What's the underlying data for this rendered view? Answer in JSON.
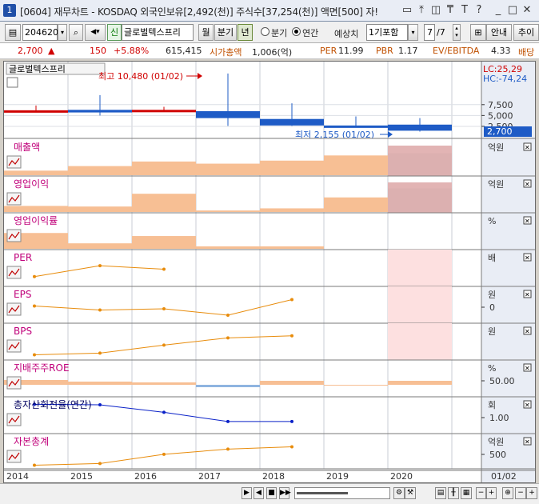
{
  "window": {
    "title": "[0604] 재무차트 - KOSDAQ 외국인보유[2,492(천)] 주식수[37,254(천)] 액면[500] 자!",
    "icon_label": "1"
  },
  "toolbar": {
    "code": "204620",
    "badge": "신",
    "company": "글로벌텍스프리",
    "btn_month": "월",
    "btn_quarter": "분기",
    "btn_year": "년",
    "radio_quarter": "분기",
    "radio_year": "연간",
    "forecast_label": "예상치",
    "forecast_select": "1기포함",
    "page_value": "7",
    "page_total": "/7",
    "guide_button": "안내",
    "add_button": "추이"
  },
  "info": {
    "price": "2,700",
    "change": "150",
    "rate": "+5.88%",
    "volume": "615,415",
    "mcap_label": "시가총액",
    "mcap_value": "1,006(억)",
    "per_label": "PER",
    "per_value": "11.99",
    "pbr_label": "PBR",
    "pbr_value": "1.17",
    "ev_label": "EV/EBITDA",
    "ev_value": "4.33",
    "div_label": "배당"
  },
  "price_panel": {
    "legend": "글로벌텍스프리",
    "high_label": "최고 10,480 (01/02)",
    "low_label": "최저 2,155 (01/02)",
    "lc": "LC:25,29",
    "hc": "HC:-74,24",
    "ticks": [
      "7,500",
      "5,000",
      "2,500"
    ],
    "current_price": "2,700",
    "colors": {
      "up": "#d00000",
      "down": "#1e5bc6"
    }
  },
  "years": [
    "2014",
    "2015",
    "2016",
    "2017",
    "2018",
    "2019",
    "2020"
  ],
  "date_label": "01/02",
  "panels": [
    {
      "title": "매출액",
      "unit": "억원",
      "ticks": []
    },
    {
      "title": "영업이익",
      "unit": "억원",
      "ticks": []
    },
    {
      "title": "영업이익률",
      "unit": "%",
      "ticks": []
    },
    {
      "title": "PER",
      "unit": "배",
      "ticks": []
    },
    {
      "title": "EPS",
      "unit": "원",
      "ticks": [
        "0"
      ]
    },
    {
      "title": "BPS",
      "unit": "원",
      "ticks": []
    },
    {
      "title": "지배주주ROE",
      "unit": "%",
      "ticks": [
        "50.00"
      ]
    },
    {
      "title": "총자산회전율(연간)",
      "unit": "회",
      "ticks": [
        "1.00"
      ]
    },
    {
      "title": "자본총계",
      "unit": "억원",
      "ticks": [
        "500"
      ]
    }
  ],
  "chart_data": {
    "type": "bar",
    "categories": [
      "2014",
      "2015",
      "2016",
      "2017",
      "2018",
      "2019",
      "2020"
    ],
    "candles": [
      {
        "year": "2014",
        "open": 2000,
        "close": 2000,
        "high": 3100,
        "low": 1900
      },
      {
        "year": "2015",
        "open": 2100,
        "close": 1500,
        "high": 5500,
        "low": 800
      },
      {
        "year": "2016",
        "open": 2000,
        "close": 2100,
        "high": 2800,
        "low": 1800
      },
      {
        "year": "2017",
        "open": 1800,
        "close": 200,
        "high": 10480,
        "low": -1600
      },
      {
        "year": "2018",
        "open": 0,
        "close": -1500,
        "high": 3600,
        "low": -1600
      },
      {
        "year": "2019",
        "open": -1500,
        "close": -1700,
        "high": 600,
        "low": -1900
      },
      {
        "year": "2020",
        "open": -1300,
        "close": -2700,
        "high": 200,
        "low": -2900
      }
    ],
    "series": [
      {
        "name": "매출액",
        "values": [
          15,
          30,
          45,
          38,
          48,
          65,
          72
        ]
      },
      {
        "name": "영업이익",
        "values": [
          20,
          18,
          60,
          5,
          12,
          48,
          78
        ]
      },
      {
        "name": "영업이익률",
        "values": [
          52,
          18,
          42,
          8,
          8,
          0,
          0
        ]
      },
      {
        "name": "PER",
        "values": [
          20,
          58,
          46,
          null,
          null,
          null,
          null
        ],
        "forecast_2020": null
      },
      {
        "name": "EPS",
        "values": [
          46,
          32,
          36,
          14,
          68,
          null,
          null
        ]
      },
      {
        "name": "BPS",
        "values": [
          4,
          10,
          38,
          63,
          70,
          null,
          null
        ]
      },
      {
        "name": "지배주주ROE",
        "values": [
          12,
          8,
          6,
          -6,
          10,
          0,
          10
        ]
      },
      {
        "name": "총자산회전율(연간)",
        "values": [
          88,
          86,
          60,
          28,
          28,
          null,
          null
        ]
      },
      {
        "name": "자본총계",
        "values": [
          4,
          10,
          42,
          60,
          68,
          null,
          null
        ]
      }
    ],
    "forecast_year": "2020"
  }
}
